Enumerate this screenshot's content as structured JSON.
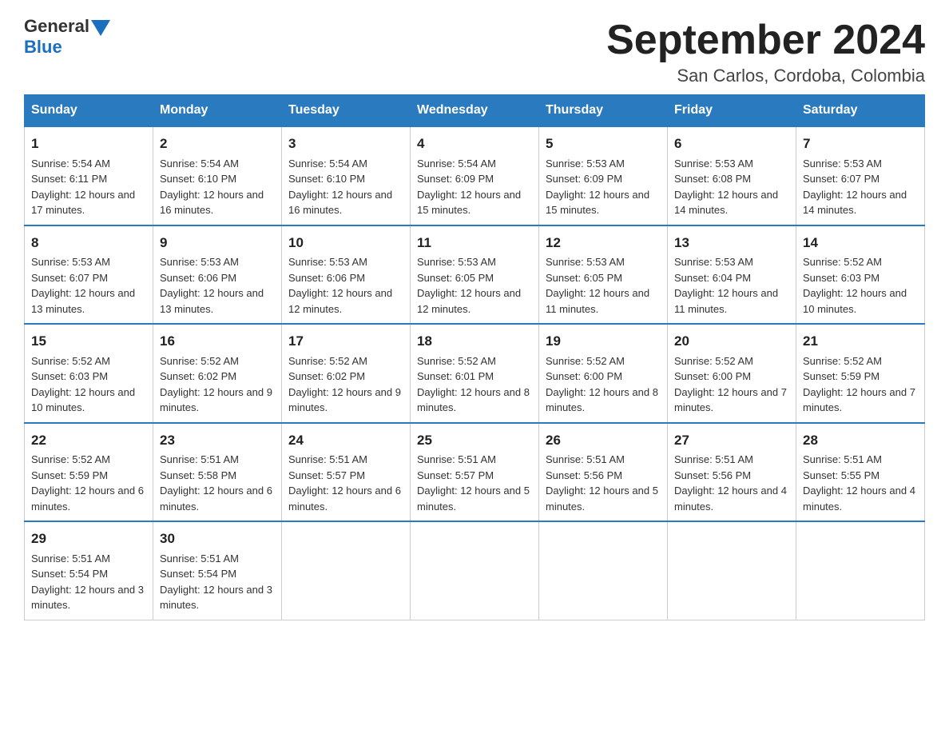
{
  "logo": {
    "general": "General",
    "blue": "Blue"
  },
  "title": "September 2024",
  "location": "San Carlos, Cordoba, Colombia",
  "days_of_week": [
    "Sunday",
    "Monday",
    "Tuesday",
    "Wednesday",
    "Thursday",
    "Friday",
    "Saturday"
  ],
  "weeks": [
    [
      {
        "day": "1",
        "sunrise": "Sunrise: 5:54 AM",
        "sunset": "Sunset: 6:11 PM",
        "daylight": "Daylight: 12 hours and 17 minutes."
      },
      {
        "day": "2",
        "sunrise": "Sunrise: 5:54 AM",
        "sunset": "Sunset: 6:10 PM",
        "daylight": "Daylight: 12 hours and 16 minutes."
      },
      {
        "day": "3",
        "sunrise": "Sunrise: 5:54 AM",
        "sunset": "Sunset: 6:10 PM",
        "daylight": "Daylight: 12 hours and 16 minutes."
      },
      {
        "day": "4",
        "sunrise": "Sunrise: 5:54 AM",
        "sunset": "Sunset: 6:09 PM",
        "daylight": "Daylight: 12 hours and 15 minutes."
      },
      {
        "day": "5",
        "sunrise": "Sunrise: 5:53 AM",
        "sunset": "Sunset: 6:09 PM",
        "daylight": "Daylight: 12 hours and 15 minutes."
      },
      {
        "day": "6",
        "sunrise": "Sunrise: 5:53 AM",
        "sunset": "Sunset: 6:08 PM",
        "daylight": "Daylight: 12 hours and 14 minutes."
      },
      {
        "day": "7",
        "sunrise": "Sunrise: 5:53 AM",
        "sunset": "Sunset: 6:07 PM",
        "daylight": "Daylight: 12 hours and 14 minutes."
      }
    ],
    [
      {
        "day": "8",
        "sunrise": "Sunrise: 5:53 AM",
        "sunset": "Sunset: 6:07 PM",
        "daylight": "Daylight: 12 hours and 13 minutes."
      },
      {
        "day": "9",
        "sunrise": "Sunrise: 5:53 AM",
        "sunset": "Sunset: 6:06 PM",
        "daylight": "Daylight: 12 hours and 13 minutes."
      },
      {
        "day": "10",
        "sunrise": "Sunrise: 5:53 AM",
        "sunset": "Sunset: 6:06 PM",
        "daylight": "Daylight: 12 hours and 12 minutes."
      },
      {
        "day": "11",
        "sunrise": "Sunrise: 5:53 AM",
        "sunset": "Sunset: 6:05 PM",
        "daylight": "Daylight: 12 hours and 12 minutes."
      },
      {
        "day": "12",
        "sunrise": "Sunrise: 5:53 AM",
        "sunset": "Sunset: 6:05 PM",
        "daylight": "Daylight: 12 hours and 11 minutes."
      },
      {
        "day": "13",
        "sunrise": "Sunrise: 5:53 AM",
        "sunset": "Sunset: 6:04 PM",
        "daylight": "Daylight: 12 hours and 11 minutes."
      },
      {
        "day": "14",
        "sunrise": "Sunrise: 5:52 AM",
        "sunset": "Sunset: 6:03 PM",
        "daylight": "Daylight: 12 hours and 10 minutes."
      }
    ],
    [
      {
        "day": "15",
        "sunrise": "Sunrise: 5:52 AM",
        "sunset": "Sunset: 6:03 PM",
        "daylight": "Daylight: 12 hours and 10 minutes."
      },
      {
        "day": "16",
        "sunrise": "Sunrise: 5:52 AM",
        "sunset": "Sunset: 6:02 PM",
        "daylight": "Daylight: 12 hours and 9 minutes."
      },
      {
        "day": "17",
        "sunrise": "Sunrise: 5:52 AM",
        "sunset": "Sunset: 6:02 PM",
        "daylight": "Daylight: 12 hours and 9 minutes."
      },
      {
        "day": "18",
        "sunrise": "Sunrise: 5:52 AM",
        "sunset": "Sunset: 6:01 PM",
        "daylight": "Daylight: 12 hours and 8 minutes."
      },
      {
        "day": "19",
        "sunrise": "Sunrise: 5:52 AM",
        "sunset": "Sunset: 6:00 PM",
        "daylight": "Daylight: 12 hours and 8 minutes."
      },
      {
        "day": "20",
        "sunrise": "Sunrise: 5:52 AM",
        "sunset": "Sunset: 6:00 PM",
        "daylight": "Daylight: 12 hours and 7 minutes."
      },
      {
        "day": "21",
        "sunrise": "Sunrise: 5:52 AM",
        "sunset": "Sunset: 5:59 PM",
        "daylight": "Daylight: 12 hours and 7 minutes."
      }
    ],
    [
      {
        "day": "22",
        "sunrise": "Sunrise: 5:52 AM",
        "sunset": "Sunset: 5:59 PM",
        "daylight": "Daylight: 12 hours and 6 minutes."
      },
      {
        "day": "23",
        "sunrise": "Sunrise: 5:51 AM",
        "sunset": "Sunset: 5:58 PM",
        "daylight": "Daylight: 12 hours and 6 minutes."
      },
      {
        "day": "24",
        "sunrise": "Sunrise: 5:51 AM",
        "sunset": "Sunset: 5:57 PM",
        "daylight": "Daylight: 12 hours and 6 minutes."
      },
      {
        "day": "25",
        "sunrise": "Sunrise: 5:51 AM",
        "sunset": "Sunset: 5:57 PM",
        "daylight": "Daylight: 12 hours and 5 minutes."
      },
      {
        "day": "26",
        "sunrise": "Sunrise: 5:51 AM",
        "sunset": "Sunset: 5:56 PM",
        "daylight": "Daylight: 12 hours and 5 minutes."
      },
      {
        "day": "27",
        "sunrise": "Sunrise: 5:51 AM",
        "sunset": "Sunset: 5:56 PM",
        "daylight": "Daylight: 12 hours and 4 minutes."
      },
      {
        "day": "28",
        "sunrise": "Sunrise: 5:51 AM",
        "sunset": "Sunset: 5:55 PM",
        "daylight": "Daylight: 12 hours and 4 minutes."
      }
    ],
    [
      {
        "day": "29",
        "sunrise": "Sunrise: 5:51 AM",
        "sunset": "Sunset: 5:54 PM",
        "daylight": "Daylight: 12 hours and 3 minutes."
      },
      {
        "day": "30",
        "sunrise": "Sunrise: 5:51 AM",
        "sunset": "Sunset: 5:54 PM",
        "daylight": "Daylight: 12 hours and 3 minutes."
      },
      null,
      null,
      null,
      null,
      null
    ]
  ]
}
